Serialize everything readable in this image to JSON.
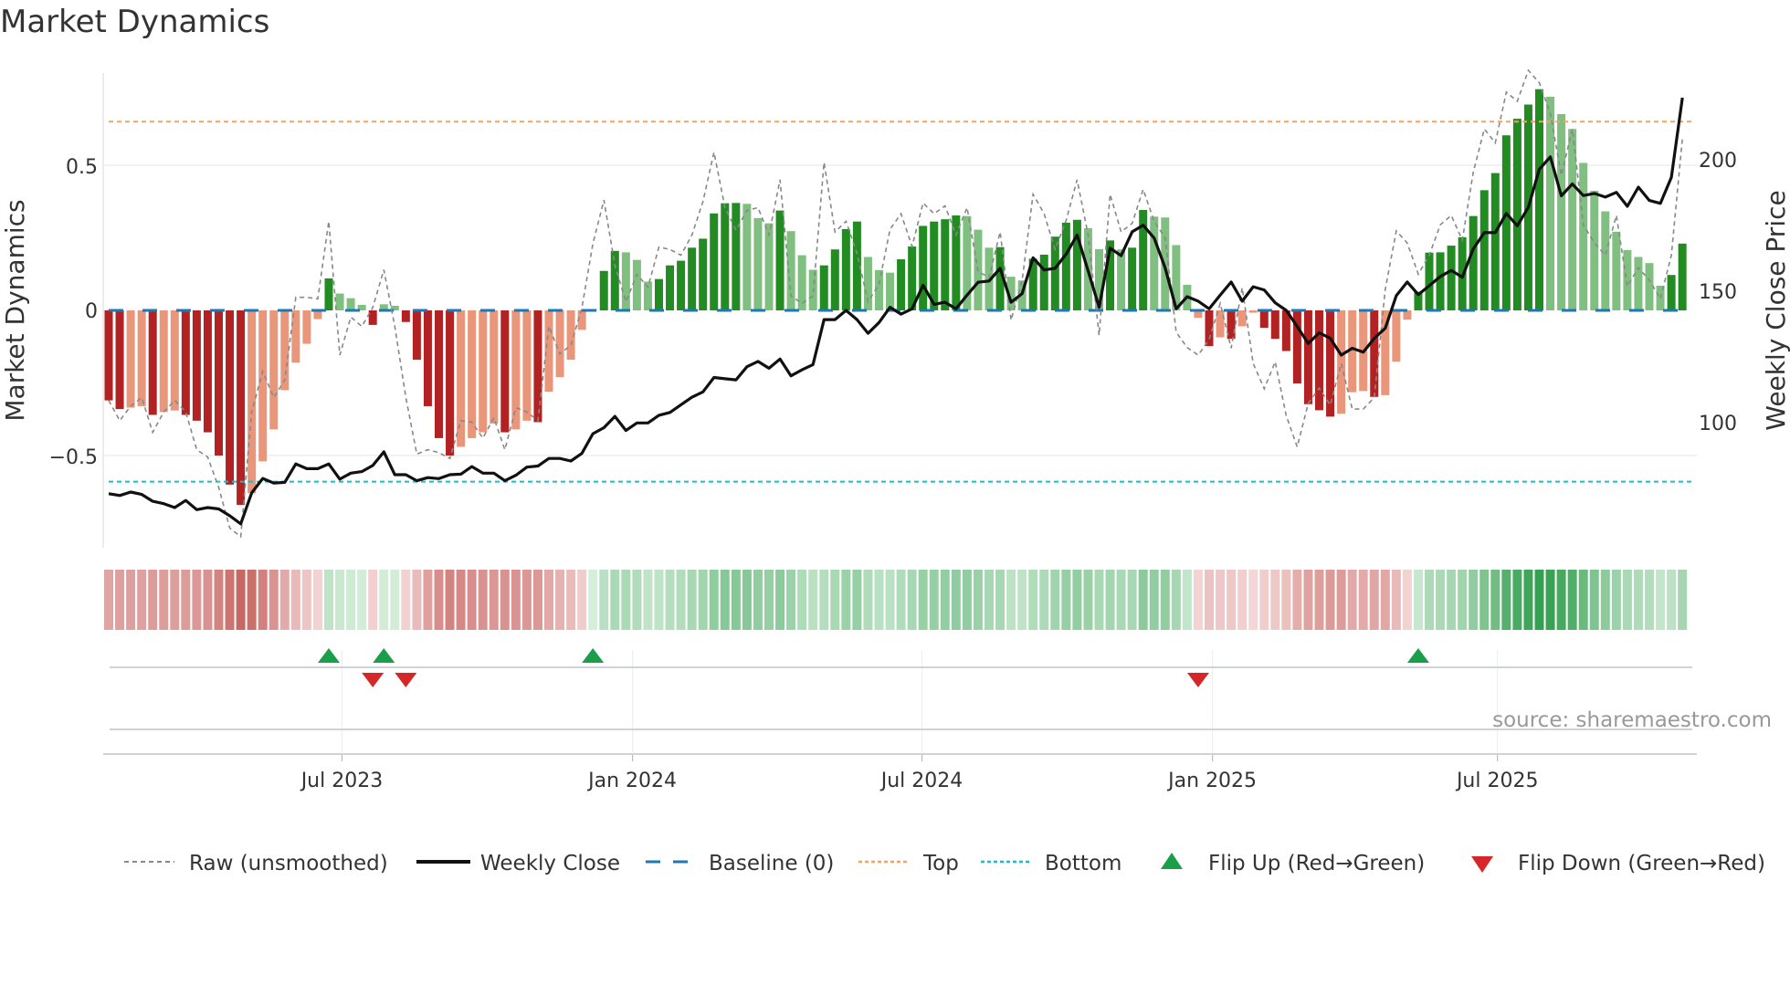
{
  "title": "Market Dynamics",
  "source": "source: sharemaestro.com",
  "colors": {
    "dark_red": "#b22222",
    "light_red": "#e9967a",
    "dark_green": "#228b22",
    "light_green": "#7fbf7f",
    "raw": "#888888",
    "close": "#111111",
    "baseline": "#1f77b4",
    "top": "#f4a460",
    "bottom": "#17becf",
    "flip_up": "#1a9e4a",
    "flip_down": "#d62728"
  },
  "chart_data": {
    "type": "bar",
    "title": "Market Dynamics",
    "ylabel": "Market Dynamics",
    "y2label": "Weekly Close Price",
    "ylim": [
      -0.82,
      0.82
    ],
    "y2lim": [
      55,
      235
    ],
    "y_ticks": [
      {
        "v": 0.5,
        "label": "0.5"
      },
      {
        "v": 0,
        "label": "0"
      },
      {
        "v": -0.5,
        "label": "−0.5"
      }
    ],
    "y2_ticks": [
      {
        "v": 200,
        "label": "200"
      },
      {
        "v": 150,
        "label": "150"
      },
      {
        "v": 100,
        "label": "100"
      }
    ],
    "x_ticks": [
      {
        "week": 21.2,
        "label": "Jul 2023"
      },
      {
        "week": 47.6,
        "label": "Jan 2024"
      },
      {
        "week": 73.9,
        "label": "Jul 2024"
      },
      {
        "week": 100.3,
        "label": "Jan 2025"
      },
      {
        "week": 126.2,
        "label": "Jul 2025"
      }
    ],
    "top_level": 0.65,
    "bottom_level": -0.59,
    "baseline": 0,
    "smoothed": [
      -0.31,
      -0.34,
      -0.335,
      -0.33,
      -0.36,
      -0.35,
      -0.345,
      -0.36,
      -0.38,
      -0.42,
      -0.5,
      -0.6,
      -0.67,
      -0.63,
      -0.52,
      -0.41,
      -0.275,
      -0.18,
      -0.115,
      -0.03,
      0.11,
      0.058,
      0.042,
      0.019,
      -0.05,
      0.021,
      0.016,
      -0.04,
      -0.17,
      -0.33,
      -0.44,
      -0.5,
      -0.47,
      -0.44,
      -0.42,
      -0.39,
      -0.42,
      -0.41,
      -0.38,
      -0.385,
      -0.28,
      -0.23,
      -0.17,
      -0.067,
      0.004,
      0.136,
      0.205,
      0.2,
      0.174,
      0.099,
      0.108,
      0.155,
      0.171,
      0.216,
      0.247,
      0.334,
      0.369,
      0.37,
      0.367,
      0.318,
      0.3,
      0.344,
      0.273,
      0.19,
      0.14,
      0.155,
      0.21,
      0.28,
      0.306,
      0.184,
      0.139,
      0.13,
      0.176,
      0.22,
      0.291,
      0.306,
      0.314,
      0.327,
      0.325,
      0.278,
      0.216,
      0.218,
      0.116,
      0.103,
      0.178,
      0.192,
      0.254,
      0.302,
      0.312,
      0.283,
      0.211,
      0.241,
      0.21,
      0.216,
      0.346,
      0.323,
      0.32,
      0.225,
      0.088,
      -0.026,
      -0.123,
      -0.093,
      -0.098,
      -0.055,
      -0.008,
      -0.06,
      -0.098,
      -0.14,
      -0.252,
      -0.323,
      -0.344,
      -0.366,
      -0.356,
      -0.282,
      -0.278,
      -0.298,
      -0.292,
      -0.177,
      -0.032,
      0.064,
      0.199,
      0.2,
      0.223,
      0.252,
      0.325,
      0.414,
      0.473,
      0.603,
      0.66,
      0.709,
      0.762,
      0.736,
      0.676,
      0.625,
      0.508,
      0.412,
      0.341,
      0.271,
      0.208,
      0.184,
      0.163,
      0.085,
      0.122,
      0.23
    ],
    "raw": [
      -0.31,
      -0.38,
      -0.33,
      -0.3,
      -0.42,
      -0.35,
      -0.31,
      -0.35,
      -0.48,
      -0.505,
      -0.61,
      -0.75,
      -0.78,
      -0.35,
      -0.21,
      -0.3,
      -0.24,
      0.045,
      0.045,
      0.04,
      0.307,
      -0.154,
      -0.023,
      -0.055,
      0.01,
      0.14,
      -0.055,
      -0.3,
      -0.495,
      -0.48,
      -0.49,
      -0.51,
      -0.38,
      -0.385,
      -0.44,
      -0.37,
      -0.48,
      -0.335,
      -0.35,
      -0.38,
      -0.055,
      -0.15,
      -0.12,
      0.008,
      0.23,
      0.38,
      0.155,
      0.03,
      0.124,
      0.08,
      0.218,
      0.21,
      0.19,
      0.26,
      0.375,
      0.545,
      0.354,
      0.276,
      0.344,
      0.354,
      0.26,
      0.45,
      0.05,
      0.024,
      0.05,
      0.51,
      0.27,
      0.307,
      0.197,
      0.03,
      0.09,
      0.28,
      0.333,
      0.22,
      0.37,
      0.333,
      0.36,
      0.26,
      0.354,
      0.134,
      0.113,
      0.27,
      -0.034,
      0.103,
      0.4,
      0.333,
      0.21,
      0.31,
      0.45,
      0.26,
      -0.086,
      0.4,
      0.27,
      0.3,
      0.417,
      0.307,
      0.25,
      -0.075,
      -0.128,
      -0.154,
      -0.1,
      0.024,
      -0.13,
      0.078,
      -0.183,
      -0.27,
      -0.177,
      -0.363,
      -0.47,
      -0.32,
      -0.268,
      -0.326,
      -0.183,
      -0.34,
      -0.34,
      -0.3,
      0.072,
      0.274,
      0.232,
      0.125,
      0.19,
      0.295,
      0.327,
      0.242,
      0.476,
      0.625,
      0.577,
      0.752,
      0.72,
      0.827,
      0.784,
      0.678,
      0.465,
      0.625,
      0.295,
      0.232,
      0.19,
      0.327,
      0.083,
      0.147,
      0.104,
      0.04,
      0.19,
      0.593
    ],
    "weekly_close": [
      73.0,
      72.3,
      73.6,
      72.7,
      70.1,
      69.2,
      67.7,
      70.4,
      66.9,
      67.7,
      67.2,
      64.6,
      61.5,
      73.3,
      78.8,
      77.0,
      77.3,
      84.3,
      82.5,
      82.5,
      84.3,
      78.5,
      80.8,
      81.4,
      83.7,
      88.9,
      80.2,
      80.2,
      77.9,
      79.1,
      78.7,
      80.2,
      80.4,
      83.3,
      80.8,
      80.8,
      77.9,
      80.0,
      83.1,
      83.5,
      86.4,
      86.4,
      85.4,
      88.3,
      95.8,
      98.1,
      102.4,
      97.0,
      99.9,
      99.9,
      102.8,
      103.9,
      106.8,
      109.7,
      111.7,
      117.2,
      116.7,
      116.3,
      121.3,
      123.3,
      120.7,
      124.2,
      117.8,
      120.1,
      122.1,
      139.2,
      139.2,
      142.7,
      139.2,
      134.0,
      138.1,
      143.9,
      141.3,
      143.3,
      152.3,
      145.0,
      145.8,
      143.3,
      148.5,
      153.4,
      153.9,
      158.7,
      145.8,
      149.1,
      162.7,
      158.1,
      158.7,
      164.1,
      171.4,
      157.7,
      143.9,
      166.4,
      163.5,
      172.6,
      175.1,
      170.2,
      158.9,
      143.3,
      147.9,
      146.2,
      143.3,
      148.5,
      153.5,
      146.2,
      151.7,
      150.5,
      145.6,
      142.7,
      136.6,
      130.1,
      134.2,
      132.1,
      125.7,
      128.3,
      126.8,
      132.1,
      135.9,
      148.3,
      153.5,
      148.7,
      152.1,
      155.6,
      157.9,
      155.3,
      166.1,
      172.3,
      172.3,
      179.6,
      174.9,
      181.9,
      196.4,
      201.1,
      186.3,
      190.8,
      186.4,
      187.2,
      185.8,
      187.6,
      182.3,
      189.6,
      184.5,
      183.4,
      193.3,
      223.6
    ],
    "flip_up_weeks": [
      21,
      26,
      45,
      120
    ],
    "flip_down_weeks": [
      25,
      28,
      100
    ],
    "legend": [
      {
        "key": "raw",
        "label": "Raw (unsmoothed)"
      },
      {
        "key": "close",
        "label": "Weekly Close"
      },
      {
        "key": "baseline",
        "label": "Baseline (0)"
      },
      {
        "key": "top",
        "label": "Top"
      },
      {
        "key": "bottom",
        "label": "Bottom"
      },
      {
        "key": "flip_up",
        "label": "Flip Up (Red→Green)"
      },
      {
        "key": "flip_down",
        "label": "Flip Down (Green→Red)"
      }
    ],
    "legend_position": "bottom"
  }
}
